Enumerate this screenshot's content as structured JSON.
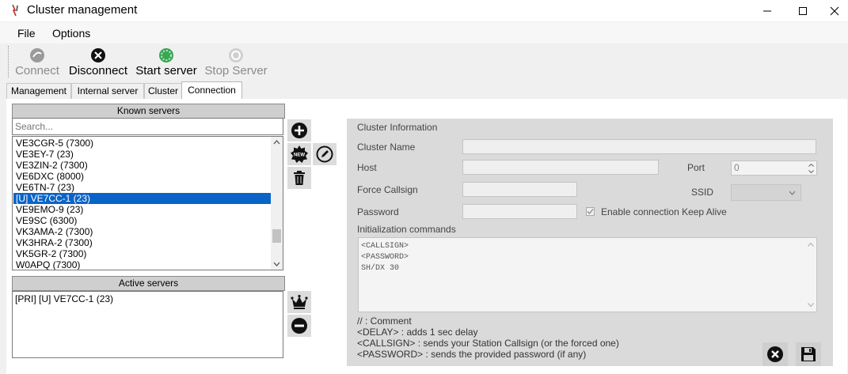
{
  "window": {
    "title": "Cluster management"
  },
  "menu": {
    "file": "File",
    "options": "Options"
  },
  "toolbar": {
    "connect": "Connect",
    "disconnect": "Disconnect",
    "start_server": "Start server",
    "stop_server": "Stop Server"
  },
  "tabs": {
    "management": "Management",
    "internal_server": "Internal server",
    "cluster": "Cluster",
    "connection": "Connection"
  },
  "known_servers": {
    "header": "Known servers",
    "search_placeholder": "Search...",
    "items": [
      "VE3CGR-5 (7300)",
      "VE3EY-7 (23)",
      "VE3ZIN-2 (7300)",
      "VE6DXC (8000)",
      "VE6TN-7 (23)",
      "[U] VE7CC-1 (23)",
      "VE9EMO-9 (23)",
      "VE9SC (6300)",
      "VK3AMA-2 (7300)",
      "VK3HRA-2 (7300)",
      "VK5GR-2 (7300)",
      "W0APQ (7300)"
    ]
  },
  "active_servers": {
    "header": "Active servers",
    "items": [
      "[PRI] [U] VE7CC-1 (23)"
    ]
  },
  "cluster_info": {
    "title": "Cluster Information",
    "cluster_name_label": "Cluster Name",
    "cluster_name_value": "",
    "host_label": "Host",
    "host_value": "",
    "port_label": "Port",
    "port_value": "0",
    "force_callsign_label": "Force Callsign",
    "force_callsign_value": "",
    "ssid_label": "SSID",
    "ssid_value": "",
    "password_label": "Password",
    "password_value": "",
    "keep_alive_label": "Enable connection Keep Alive",
    "keep_alive_checked": true,
    "init_label": "Initialization commands",
    "init_lines": [
      "<CALLSIGN>",
      "<PASSWORD>",
      "SH/DX 30"
    ],
    "help": [
      "// : Comment",
      "<DELAY> : adds 1 sec delay",
      "<CALLSIGN> : sends your Station Callsign (or the forced one)",
      "<PASSWORD> : sends the provided password (if any)"
    ]
  },
  "colors": {
    "selection": "#0a64c8",
    "panel": "#dadada",
    "accent_green": "#3aa655"
  }
}
